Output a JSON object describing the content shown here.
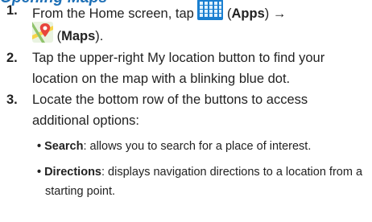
{
  "heading": "Opening Maps",
  "steps": [
    {
      "number": "1.",
      "line1_prefix": "From the Home screen, tap",
      "apps_open": "(",
      "apps_label": "Apps",
      "apps_close": ")",
      "arrow": "→",
      "line2_open": "(",
      "maps_label": "Maps",
      "line2_close": ")."
    },
    {
      "number": "2.",
      "lines": [
        "Tap the upper-right My location button to find your",
        "location on the map with a blinking blue dot."
      ]
    },
    {
      "number": "3.",
      "lines": [
        "Locate the bottom row of the buttons to access",
        "additional options:"
      ]
    }
  ],
  "bullets": [
    {
      "marker": "•",
      "term": "Search",
      "desc": ": allows you to search for a place of interest."
    },
    {
      "marker": "•",
      "term": "Directions",
      "desc": ": displays navigation directions to a location from a",
      "desc_line2": "starting point."
    }
  ],
  "icons": {
    "apps": "apps-grid-icon",
    "maps": "maps-app-icon"
  },
  "colors": {
    "heading": "#1c6fb6",
    "apps_icon": "#1a7fd0"
  }
}
